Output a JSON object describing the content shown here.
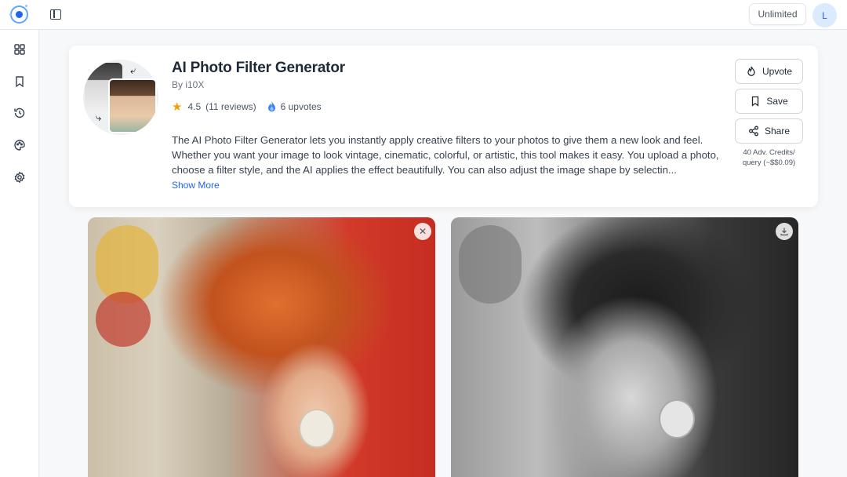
{
  "topbar": {
    "plan_label": "Unlimited",
    "avatar_initial": "L",
    "icons": [
      "app-logo-icon",
      "panel-toggle-icon"
    ]
  },
  "sidebar": {
    "items": [
      {
        "icon": "grid-icon"
      },
      {
        "icon": "bookmark-icon"
      },
      {
        "icon": "history-icon"
      },
      {
        "icon": "palette-icon"
      },
      {
        "icon": "gear-icon"
      }
    ]
  },
  "tool": {
    "title": "AI Photo Filter Generator",
    "byline": "By i10X",
    "rating": "4.5",
    "reviews": "(11 reviews)",
    "upvotes": "6 upvotes",
    "description": "The AI Photo Filter Generator lets you instantly apply creative filters to your photos to give them a new look and feel. Whether you want your image to look vintage, cinematic, colorful, or artistic, this tool makes it easy. You upload a photo, choose a filter style, and the AI applies the effect beautifully. You can also adjust the image shape by selectin...",
    "show_more": "Show More",
    "actions": {
      "upvote": "Upvote",
      "save": "Save",
      "share": "Share"
    },
    "credits_line1": "40 Adv. Credits/",
    "credits_line2": "query (~$$0.09)"
  },
  "preview": {
    "left_image": "original-color-portrait",
    "right_image": "black-and-white-filtered-portrait",
    "left_action_icon": "close-icon",
    "right_action_icon": "download-icon"
  },
  "colors": {
    "accent": "#2563eb",
    "star": "#f59e0b",
    "text": "#1f2937"
  }
}
